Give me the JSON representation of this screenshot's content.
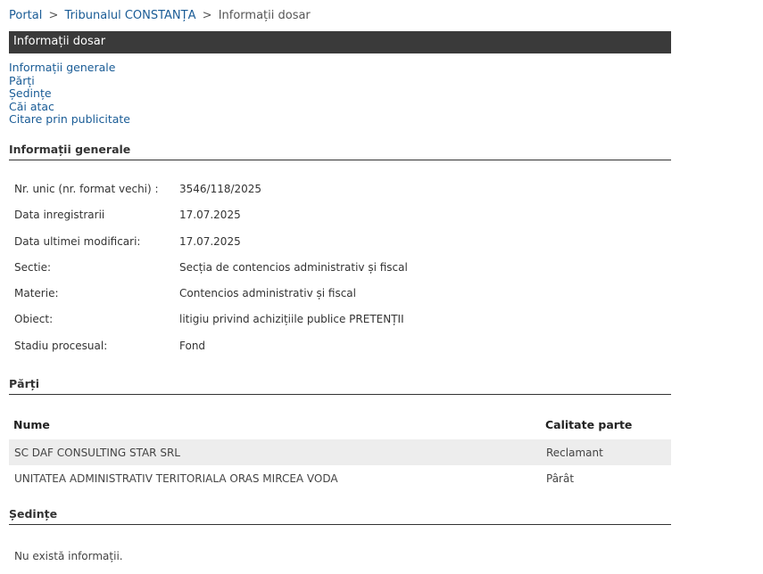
{
  "breadcrumb": {
    "portal": "Portal",
    "court": "Tribunalul CONSTANȚA",
    "current": "Informații dosar",
    "sep1": ">",
    "sep2": ">"
  },
  "title_bar": "Informații dosar",
  "anchor_nav": [
    "Informații generale",
    "Părți",
    "Ședințe",
    "Căi atac",
    "Citare prin publicitate"
  ],
  "general": {
    "heading": "Informații generale",
    "rows": [
      {
        "label": "Nr. unic (nr. format vechi) :",
        "value": "3546/118/2025"
      },
      {
        "label": "Data inregistrarii",
        "value": "17.07.2025"
      },
      {
        "label": "Data ultimei modificari:",
        "value": "17.07.2025"
      },
      {
        "label": "Sectie:",
        "value": "Secția de contencios administrativ și fiscal"
      },
      {
        "label": "Materie:",
        "value": "Contencios administrativ și fiscal"
      },
      {
        "label": "Obiect:",
        "value": "litigiu privind achizițiile publice PRETENȚII"
      },
      {
        "label": "Stadiu procesual:",
        "value": "Fond"
      }
    ]
  },
  "parties": {
    "heading": "Părți",
    "columns": [
      "Nume",
      "Calitate parte"
    ],
    "rows": [
      {
        "name": "SC DAF CONSULTING STAR SRL",
        "role": "Reclamant"
      },
      {
        "name": "UNITATEA ADMINISTRATIV TERITORIALA ORAS MIRCEA VODA",
        "role": "Pârât"
      }
    ]
  },
  "sessions": {
    "heading": "Ședințe",
    "empty_text": "Nu există informații."
  }
}
